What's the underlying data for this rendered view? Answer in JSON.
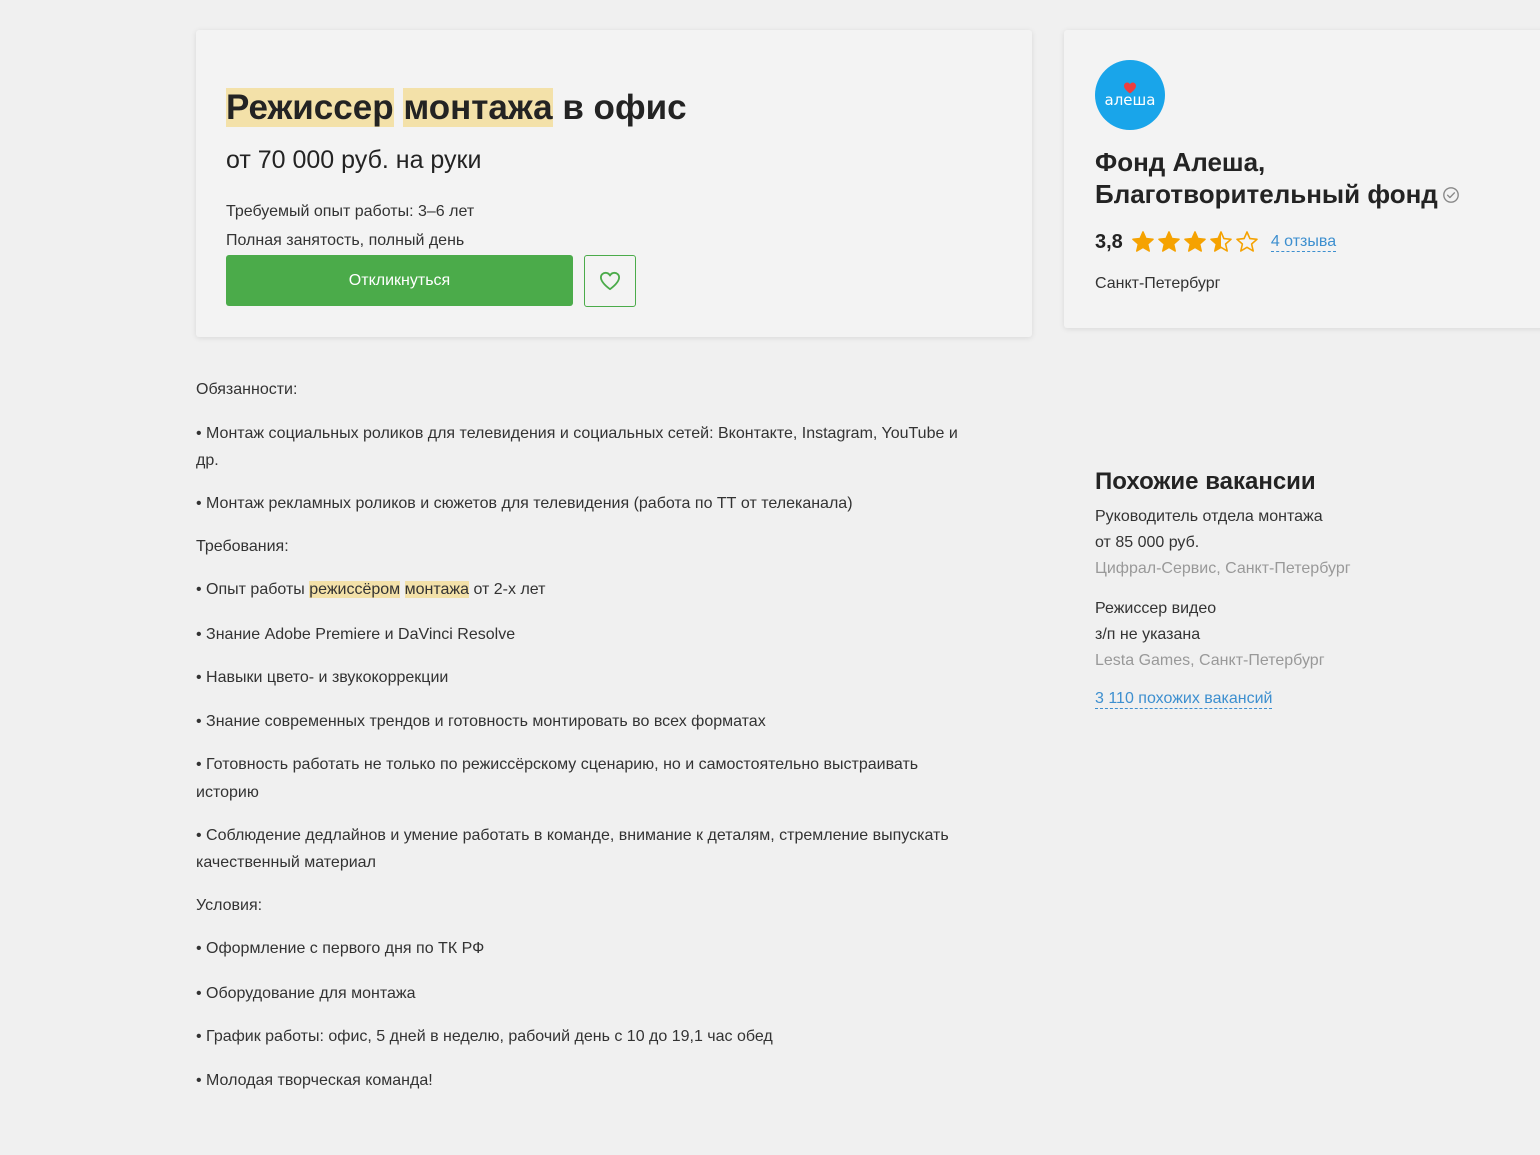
{
  "vacancy": {
    "title_hl_1": "Режиссер",
    "title_space": " ",
    "title_hl_2": "монтажа",
    "title_rest": " в офис",
    "salary": "от 70 000 руб. на руки",
    "experience": "Требуемый опыт работы: 3–6 лет",
    "employment": "Полная занятость, полный день",
    "respond_label": "Откликнуться",
    "favorite_icon": "heart-icon"
  },
  "employer": {
    "logo_text": "алеша",
    "name": "Фонд Алеша, Благотворительный фонд",
    "verified_icon": "check-circle-icon",
    "rating": "3,8",
    "stars": 3.5,
    "stars_max": 5,
    "reviews": "4 отзыва",
    "city": "Санкт-Петербург"
  },
  "description": {
    "duties_heading": "Обязанности:",
    "duty_1_a": "• Монтаж социальных роликов для телевидения и социальных сетей: Вконтакте, Instagram, YouTube и",
    "duty_1_b": "др.",
    "duty_2": "• Монтаж рекламных роликов и сюжетов для телевидения (работа по ТТ от телеканала)",
    "req_heading": "Требования:",
    "req_1_pre": "• Опыт работы ",
    "req_1_hl_1": "режиссёром",
    "req_1_hl_2": "монтажа",
    "req_1_post": " от 2-х лет",
    "req_2": "• Знание Adobe Premiere и DaVinci Resolve",
    "req_3": "• Навыки цвето- и звукокоррекции",
    "req_4": "• Знание современных трендов и готовность монтировать во всех форматах",
    "req_5_a": "• Готовность работать не только по режиссёрскому сценарию, но и самостоятельно выстраивать",
    "req_5_b": "историю",
    "req_6_a": "• Соблюдение дедлайнов и умение работать в команде, внимание к деталям, стремление выпускать",
    "req_6_b": "качественный материал",
    "cond_heading": "Условия:",
    "cond_1": "• Оформление с первого дня по ТК РФ",
    "cond_2": "• Оборудование для монтажа",
    "cond_3": "• График работы: офис, 5 дней в неделю, рабочий день с 10 до 19,1 час обед",
    "cond_4": "• Молодая творческая команда!"
  },
  "similar": {
    "title": "Похожие вакансии",
    "items": [
      {
        "title": "Руководитель отдела монтажа",
        "salary": "от 85 000 руб.",
        "company": "Цифрал-Сервис, Санкт-Петербург"
      },
      {
        "title": "Режиссер видео",
        "salary": "з/п не указана",
        "company": "Lesta Games, Санкт-Петербург"
      }
    ],
    "more_link": "3 110 похожих вакансий"
  },
  "colors": {
    "accent_green": "#4bab4a",
    "highlight": "#f3e1a9",
    "link_blue": "#3d8fcf",
    "star_orange": "#f5a201",
    "logo_blue": "#19a5ea"
  }
}
